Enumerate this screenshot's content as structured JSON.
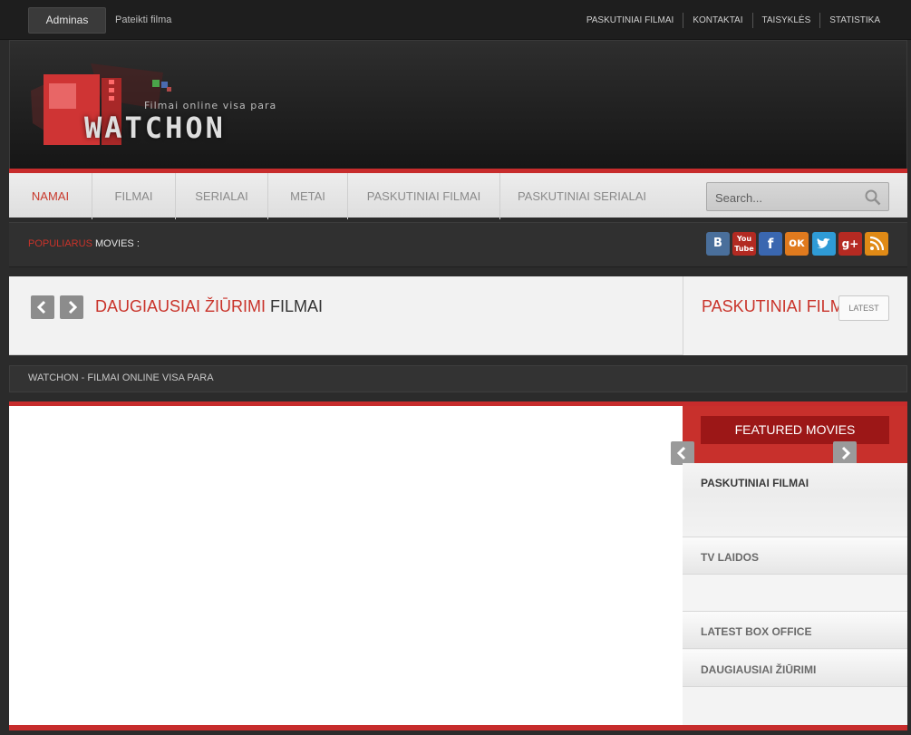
{
  "topbar": {
    "admin_label": "Adminas",
    "submit_label": "Pateikti filma",
    "nav": [
      "PASKUTINIAI FILMAI",
      "KONTAKTAI",
      "TAISYKLĖS",
      "STATISTIKA"
    ]
  },
  "header": {
    "logo_subtitle": "Filmai online visa para",
    "logo_title": "WATCHON"
  },
  "mainnav": {
    "items": [
      "NAMAI",
      "FILMAI",
      "SERIALAI",
      "METAI",
      "PASKUTINIAI FILMAI",
      "PASKUTINIAI SERIALAI"
    ],
    "search_placeholder": "Search..."
  },
  "popular": {
    "label_red": "POPULIARUS",
    "label_white": "MOVIES :"
  },
  "social": [
    "vk-icon",
    "youtube-icon",
    "facebook-icon",
    "odnoklassniki-icon",
    "twitter-icon",
    "google-plus-icon",
    "rss-icon"
  ],
  "panel": {
    "title_red": "DAUGIAUSIAI ŽIŪRIMI",
    "title_dark": "FILMAI",
    "right_title": "PASKUTINIAI FILMAI",
    "latest_label": "LATEST"
  },
  "breadcrumb": "WATCHON - FILMAI ONLINE VISA PARA",
  "sidebar": {
    "featured_label": "FEATURED MOVIES",
    "items": [
      "PASKUTINIAI FILMAI",
      "TV LAIDOS",
      "LATEST BOX OFFICE",
      "DAUGIAUSIAI ŽIŪRIMI"
    ]
  },
  "colors": {
    "accent": "#c72c2c",
    "dark_red": "#9c1717"
  }
}
